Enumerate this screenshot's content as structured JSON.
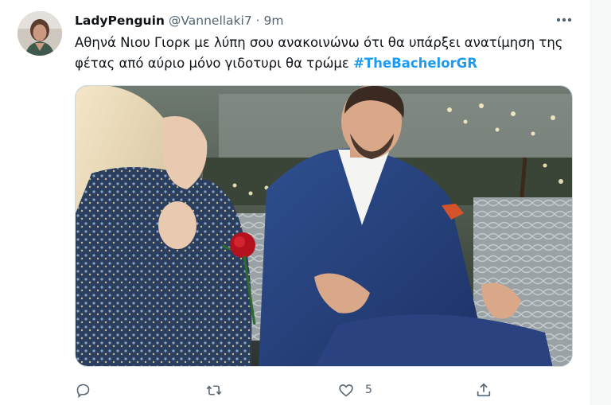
{
  "tweet": {
    "display_name": "LadyPenguin",
    "handle": "@Vannellaki7",
    "separator": "·",
    "time": "9m",
    "text_line1": "Αθηνά Νιου Γιορκ με λύπη σου ανακοινώνω ότι θα υπάρξει ανατίμηση της",
    "text_line2": "φέτας από αύριο μόνο γιδοτυρι θα τρώμε ",
    "hashtag": "#TheBachelorGR"
  },
  "actions": {
    "reply_count": "",
    "retweet_count": "",
    "like_count": "5"
  },
  "colors": {
    "accent": "#1d9bf0",
    "text": "#0f1419",
    "secondary": "#536471"
  },
  "icons": [
    "more-icon",
    "reply-icon",
    "retweet-icon",
    "like-icon",
    "share-icon"
  ]
}
